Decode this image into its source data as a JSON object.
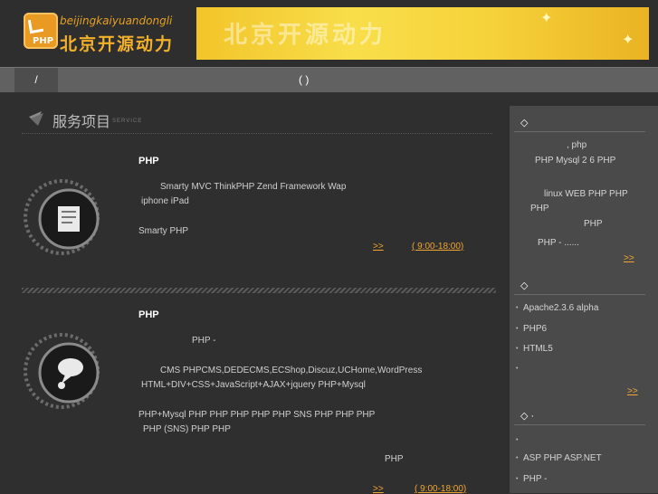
{
  "header": {
    "logo_en": "beijingkaiyuandongli",
    "logo_cn": "北京开源动力",
    "logo_badge": "PHP",
    "banner_text": "北京开源动力"
  },
  "nav": {
    "home": "/",
    "center": "(    )"
  },
  "section": {
    "title_cn": "服务项目",
    "title_en": "SERVICE"
  },
  "services": [
    {
      "title": "PHP",
      "lines": [
        "Smarty      MVC       ThinkPHP   Zend Framework                          Wap",
        "iphone iPad",
        "Smarty                PHP"
      ],
      "more": ">>",
      "hours": "(    9:00-18:00)"
    },
    {
      "title": "PHP",
      "lines": [
        "PHP                                                       -",
        "CMS  PHPCMS,DEDECMS,ECShop,Discuz,UCHome,WordPress",
        "HTML+DIV+CSS+JavaScript+AJAX+jquery       PHP+Mysql",
        "PHP+Mysql       PHP      PHP       PHP       PHP     PHP    SNS         PHP       PHP      PHP",
        "PHP    (SNS) PHP        PHP",
        "PHP"
      ],
      "more": ">>",
      "hours": "(    9:00-18:00)"
    }
  ],
  "sidebar": {
    "box1": {
      "head": "◇",
      "lines": [
        ",      php",
        "PHP Mysql   2  6    PHP",
        "linux  WEB  PHP     PHP",
        "PHP",
        "PHP",
        "PHP   -       ......"
      ],
      "more": ">>"
    },
    "box2": {
      "head": "◇",
      "items": [
        "Apache2.3.6 alpha",
        "PHP6",
        "HTML5",
        ""
      ],
      "more": ">>"
    },
    "box3": {
      "head": "◇  ·",
      "items": [
        "",
        "ASP          PHP  ASP.NET",
        "PHP   -"
      ]
    }
  },
  "colors": {
    "accent": "#f0a630",
    "banner": "#f6d23a",
    "sidebar": "#4a4a4a",
    "nav": "#616161"
  }
}
